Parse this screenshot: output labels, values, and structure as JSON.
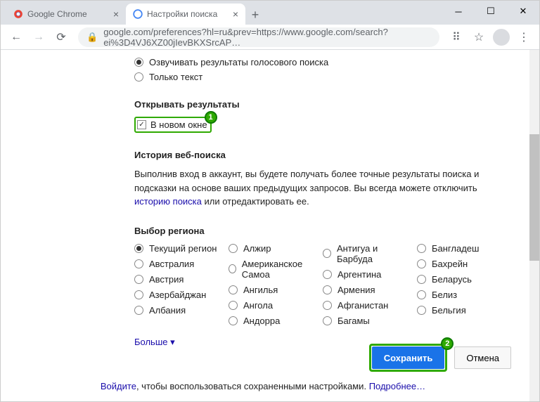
{
  "tabs": [
    {
      "title": "Google Chrome"
    },
    {
      "title": "Настройки поиска"
    }
  ],
  "url": "google.com/preferences?hl=ru&prev=https://www.google.com/search?ei%3D4VJ6XZ00jIevBKXSrcAP…",
  "voice": {
    "opt1": "Озвучивать результаты голосового поиска",
    "opt2": "Только текст"
  },
  "openResults": {
    "title": "Открывать результаты",
    "checkbox": "В новом окне"
  },
  "history": {
    "title": "История веб-поиска",
    "text1": "Выполнив вход в аккаунт, вы будете получать более точные результаты поиска и подсказки на основе ваших предыдущих запросов. Вы всегда можете отключить ",
    "link": "историю поиска",
    "text2": " или отредактировать ее."
  },
  "region": {
    "title": "Выбор региона",
    "more": "Больше",
    "cols": [
      [
        "Текущий регион",
        "Австралия",
        "Австрия",
        "Азербайджан",
        "Албания"
      ],
      [
        "Алжир",
        "Американское Самоа",
        "Ангилья",
        "Ангола",
        "Андорра"
      ],
      [
        "Антигуа и Барбуда",
        "Аргентина",
        "Армения",
        "Афганистан",
        "Багамы"
      ],
      [
        "Бангладеш",
        "Бахрейн",
        "Беларусь",
        "Белиз",
        "Бельгия"
      ]
    ]
  },
  "buttons": {
    "save": "Сохранить",
    "cancel": "Отмена"
  },
  "footer": {
    "signin": "Войдите",
    "text": ", чтобы воспользоваться сохраненными настройками. ",
    "more": "Подробнее…"
  },
  "badges": {
    "one": "1",
    "two": "2"
  }
}
